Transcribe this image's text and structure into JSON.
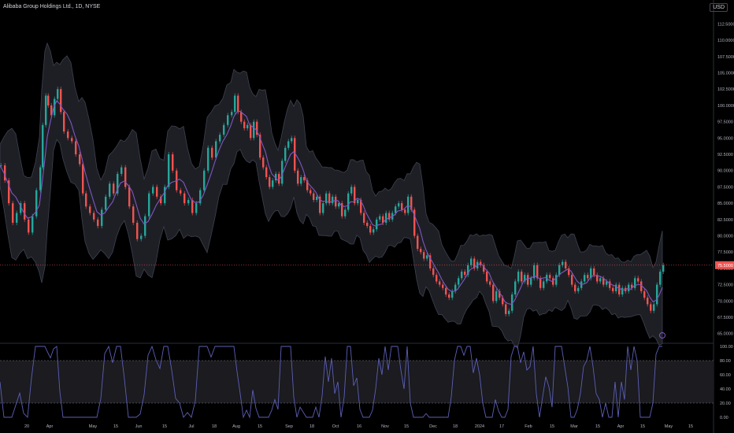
{
  "header": {
    "symbol_label": "Alibaba Group Holdings Ltd., 1D, NYSE",
    "currency": "USD"
  },
  "chart_data": {
    "type": "candlestick",
    "series": [
      {
        "name": "Candles"
      },
      {
        "name": "Moving average",
        "color": "#7e57c2"
      },
      {
        "name": "Band",
        "color": "#787b86"
      }
    ],
    "y_ticks": [
      "112.5000",
      "110.0000",
      "107.5000",
      "105.0000",
      "102.5000",
      "100.0000",
      "97.5000",
      "95.0000",
      "92.5000",
      "90.0000",
      "87.5000",
      "85.0000",
      "82.5000",
      "80.0000",
      "77.5000",
      "75.0000",
      "72.5000",
      "70.0000",
      "67.5000",
      "65.0000"
    ],
    "ylim": [
      64,
      114
    ],
    "x_ticks": [
      "20",
      "Apr",
      "May",
      "15",
      "Jun",
      "15",
      "Jul",
      "18",
      "Aug",
      "15",
      "Sep",
      "18",
      "Oct",
      "16",
      "Nov",
      "15",
      "Dec",
      "18",
      "2024",
      "17",
      "Feb",
      "15",
      "Mar",
      "15",
      "Apr",
      "15",
      "May",
      "15"
    ],
    "last_price": 75.5,
    "last_price_label": "75.5000",
    "closes": [
      {
        "x": 0,
        "y": 90.8
      },
      {
        "x": 5,
        "y": 88.5
      },
      {
        "x": 10,
        "y": 85.0
      },
      {
        "x": 15,
        "y": 82.0
      },
      {
        "x": 20,
        "y": 83.5
      },
      {
        "x": 25,
        "y": 85.0
      },
      {
        "x": 30,
        "y": 82.5
      },
      {
        "x": 35,
        "y": 80.5
      },
      {
        "x": 40,
        "y": 83.0
      },
      {
        "x": 45,
        "y": 87.0
      },
      {
        "x": 50,
        "y": 90.5
      },
      {
        "x": 53,
        "y": 97.0
      },
      {
        "x": 57,
        "y": 101.5
      },
      {
        "x": 60,
        "y": 100.0
      },
      {
        "x": 64,
        "y": 98.5
      },
      {
        "x": 68,
        "y": 101.0
      },
      {
        "x": 72,
        "y": 102.5
      },
      {
        "x": 76,
        "y": 99.0
      },
      {
        "x": 80,
        "y": 96.0
      },
      {
        "x": 85,
        "y": 95.0
      },
      {
        "x": 90,
        "y": 94.5
      },
      {
        "x": 95,
        "y": 92.5
      },
      {
        "x": 100,
        "y": 91.0
      },
      {
        "x": 104,
        "y": 86.5
      },
      {
        "x": 108,
        "y": 84.5
      },
      {
        "x": 113,
        "y": 83.5
      },
      {
        "x": 118,
        "y": 82.5
      },
      {
        "x": 123,
        "y": 81.5
      },
      {
        "x": 128,
        "y": 84.0
      },
      {
        "x": 133,
        "y": 86.0
      },
      {
        "x": 138,
        "y": 88.0
      },
      {
        "x": 143,
        "y": 86.5
      },
      {
        "x": 148,
        "y": 89.5
      },
      {
        "x": 153,
        "y": 90.5
      },
      {
        "x": 158,
        "y": 87.5
      },
      {
        "x": 163,
        "y": 84.5
      },
      {
        "x": 168,
        "y": 82.0
      },
      {
        "x": 173,
        "y": 79.5
      },
      {
        "x": 178,
        "y": 80.0
      },
      {
        "x": 183,
        "y": 83.0
      },
      {
        "x": 188,
        "y": 86.5
      },
      {
        "x": 193,
        "y": 87.5
      },
      {
        "x": 198,
        "y": 86.0
      },
      {
        "x": 203,
        "y": 85.0
      },
      {
        "x": 208,
        "y": 87.5
      },
      {
        "x": 213,
        "y": 92.5
      },
      {
        "x": 218,
        "y": 90.0
      },
      {
        "x": 223,
        "y": 87.0
      },
      {
        "x": 228,
        "y": 86.5
      },
      {
        "x": 233,
        "y": 85.0
      },
      {
        "x": 238,
        "y": 85.5
      },
      {
        "x": 243,
        "y": 83.5
      },
      {
        "x": 248,
        "y": 85.0
      },
      {
        "x": 253,
        "y": 87.0
      },
      {
        "x": 258,
        "y": 90.0
      },
      {
        "x": 263,
        "y": 93.5
      },
      {
        "x": 268,
        "y": 92.0
      },
      {
        "x": 273,
        "y": 94.5
      },
      {
        "x": 278,
        "y": 95.5
      },
      {
        "x": 283,
        "y": 97.0
      },
      {
        "x": 288,
        "y": 98.5
      },
      {
        "x": 293,
        "y": 99.0
      },
      {
        "x": 297,
        "y": 101.5
      },
      {
        "x": 301,
        "y": 99.0
      },
      {
        "x": 305,
        "y": 97.5
      },
      {
        "x": 309,
        "y": 96.5
      },
      {
        "x": 313,
        "y": 97.0
      },
      {
        "x": 317,
        "y": 95.0
      },
      {
        "x": 321,
        "y": 97.5
      },
      {
        "x": 325,
        "y": 95.5
      },
      {
        "x": 329,
        "y": 92.0
      },
      {
        "x": 333,
        "y": 90.5
      },
      {
        "x": 337,
        "y": 89.0
      },
      {
        "x": 341,
        "y": 87.5
      },
      {
        "x": 345,
        "y": 88.5
      },
      {
        "x": 349,
        "y": 89.5
      },
      {
        "x": 353,
        "y": 88.0
      },
      {
        "x": 357,
        "y": 91.5
      },
      {
        "x": 361,
        "y": 93.5
      },
      {
        "x": 365,
        "y": 94.5
      },
      {
        "x": 369,
        "y": 95.0
      },
      {
        "x": 373,
        "y": 90.0
      },
      {
        "x": 377,
        "y": 88.0
      },
      {
        "x": 381,
        "y": 89.0
      },
      {
        "x": 385,
        "y": 88.5
      },
      {
        "x": 389,
        "y": 87.0
      },
      {
        "x": 393,
        "y": 86.5
      },
      {
        "x": 397,
        "y": 85.5
      },
      {
        "x": 401,
        "y": 86.0
      },
      {
        "x": 405,
        "y": 83.5
      },
      {
        "x": 409,
        "y": 85.0
      },
      {
        "x": 413,
        "y": 86.5
      },
      {
        "x": 417,
        "y": 85.0
      },
      {
        "x": 421,
        "y": 86.0
      },
      {
        "x": 425,
        "y": 84.5
      },
      {
        "x": 429,
        "y": 85.0
      },
      {
        "x": 433,
        "y": 83.0
      },
      {
        "x": 437,
        "y": 84.0
      },
      {
        "x": 441,
        "y": 86.5
      },
      {
        "x": 445,
        "y": 87.5
      },
      {
        "x": 449,
        "y": 85.0
      },
      {
        "x": 453,
        "y": 85.5
      },
      {
        "x": 457,
        "y": 83.5
      },
      {
        "x": 461,
        "y": 82.0
      },
      {
        "x": 465,
        "y": 81.5
      },
      {
        "x": 469,
        "y": 80.5
      },
      {
        "x": 473,
        "y": 81.0
      },
      {
        "x": 477,
        "y": 82.5
      },
      {
        "x": 481,
        "y": 83.0
      },
      {
        "x": 485,
        "y": 82.0
      },
      {
        "x": 489,
        "y": 83.5
      },
      {
        "x": 493,
        "y": 82.5
      },
      {
        "x": 497,
        "y": 83.5
      },
      {
        "x": 501,
        "y": 84.5
      },
      {
        "x": 505,
        "y": 85.0
      },
      {
        "x": 509,
        "y": 84.0
      },
      {
        "x": 513,
        "y": 83.5
      },
      {
        "x": 517,
        "y": 86.0
      },
      {
        "x": 521,
        "y": 84.0
      },
      {
        "x": 525,
        "y": 80.0
      },
      {
        "x": 529,
        "y": 78.0
      },
      {
        "x": 533,
        "y": 77.5
      },
      {
        "x": 537,
        "y": 76.5
      },
      {
        "x": 541,
        "y": 77.0
      },
      {
        "x": 545,
        "y": 75.0
      },
      {
        "x": 549,
        "y": 74.0
      },
      {
        "x": 553,
        "y": 73.0
      },
      {
        "x": 557,
        "y": 72.5
      },
      {
        "x": 561,
        "y": 72.0
      },
      {
        "x": 565,
        "y": 71.0
      },
      {
        "x": 569,
        "y": 70.5
      },
      {
        "x": 573,
        "y": 71.5
      },
      {
        "x": 577,
        "y": 72.5
      },
      {
        "x": 581,
        "y": 73.5
      },
      {
        "x": 585,
        "y": 74.5
      },
      {
        "x": 589,
        "y": 74.0
      },
      {
        "x": 593,
        "y": 75.5
      },
      {
        "x": 597,
        "y": 76.5
      },
      {
        "x": 601,
        "y": 75.0
      },
      {
        "x": 605,
        "y": 76.0
      },
      {
        "x": 609,
        "y": 75.5
      },
      {
        "x": 613,
        "y": 74.5
      },
      {
        "x": 617,
        "y": 73.0
      },
      {
        "x": 621,
        "y": 72.5
      },
      {
        "x": 625,
        "y": 70.0
      },
      {
        "x": 629,
        "y": 71.5
      },
      {
        "x": 633,
        "y": 70.5
      },
      {
        "x": 637,
        "y": 69.5
      },
      {
        "x": 641,
        "y": 68.0
      },
      {
        "x": 645,
        "y": 68.5
      },
      {
        "x": 649,
        "y": 71.0
      },
      {
        "x": 653,
        "y": 73.0
      },
      {
        "x": 657,
        "y": 74.5
      },
      {
        "x": 661,
        "y": 73.0
      },
      {
        "x": 665,
        "y": 74.0
      },
      {
        "x": 669,
        "y": 72.5
      },
      {
        "x": 673,
        "y": 73.5
      },
      {
        "x": 677,
        "y": 75.5
      },
      {
        "x": 681,
        "y": 73.5
      },
      {
        "x": 685,
        "y": 72.0
      },
      {
        "x": 689,
        "y": 73.0
      },
      {
        "x": 693,
        "y": 74.0
      },
      {
        "x": 697,
        "y": 73.5
      },
      {
        "x": 701,
        "y": 72.5
      },
      {
        "x": 705,
        "y": 74.0
      },
      {
        "x": 709,
        "y": 75.5
      },
      {
        "x": 713,
        "y": 76.0
      },
      {
        "x": 717,
        "y": 75.0
      },
      {
        "x": 721,
        "y": 74.0
      },
      {
        "x": 725,
        "y": 72.5
      },
      {
        "x": 729,
        "y": 71.5
      },
      {
        "x": 733,
        "y": 72.0
      },
      {
        "x": 737,
        "y": 73.0
      },
      {
        "x": 741,
        "y": 74.0
      },
      {
        "x": 745,
        "y": 73.5
      },
      {
        "x": 749,
        "y": 75.0
      },
      {
        "x": 753,
        "y": 74.0
      },
      {
        "x": 757,
        "y": 73.0
      },
      {
        "x": 761,
        "y": 73.5
      },
      {
        "x": 765,
        "y": 72.5
      },
      {
        "x": 769,
        "y": 73.0
      },
      {
        "x": 773,
        "y": 72.0
      },
      {
        "x": 777,
        "y": 71.5
      },
      {
        "x": 781,
        "y": 72.5
      },
      {
        "x": 785,
        "y": 71.0
      },
      {
        "x": 789,
        "y": 72.0
      },
      {
        "x": 793,
        "y": 71.5
      },
      {
        "x": 797,
        "y": 72.5
      },
      {
        "x": 801,
        "y": 72.0
      },
      {
        "x": 805,
        "y": 73.5
      },
      {
        "x": 809,
        "y": 73.0
      },
      {
        "x": 813,
        "y": 71.5
      },
      {
        "x": 817,
        "y": 70.5
      },
      {
        "x": 821,
        "y": 69.5
      },
      {
        "x": 825,
        "y": 68.5
      },
      {
        "x": 829,
        "y": 69.5
      },
      {
        "x": 833,
        "y": 72.5
      },
      {
        "x": 837,
        "y": 74.5
      },
      {
        "x": 841,
        "y": 75.5
      }
    ],
    "oscillator": {
      "y_ticks": [
        "100.00",
        "80.00",
        "60.00",
        "40.00",
        "20.00",
        "0.00"
      ],
      "ylim": [
        0,
        100
      ],
      "levels": [
        80,
        20
      ]
    }
  }
}
